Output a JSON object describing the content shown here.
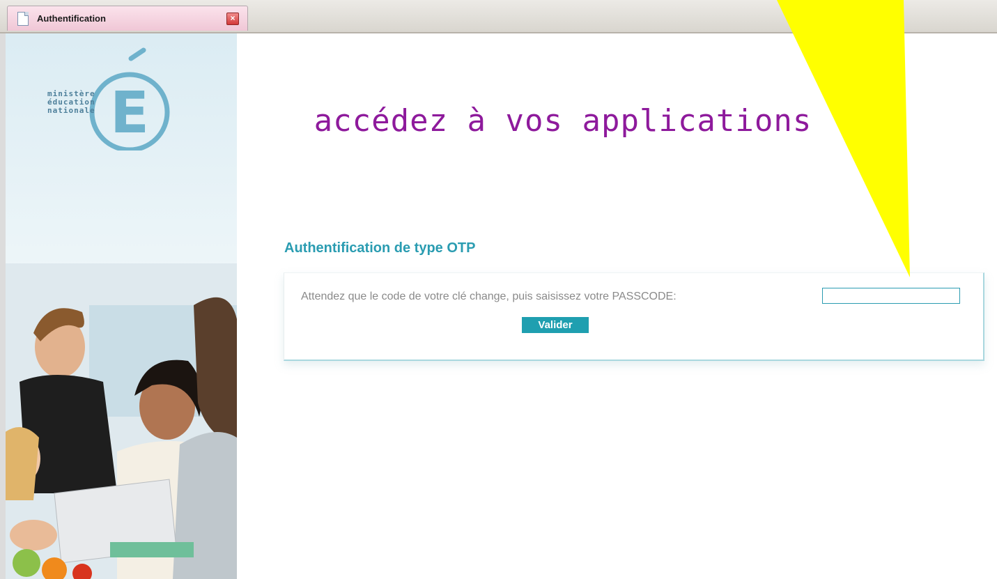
{
  "browser": {
    "tab_title": "Authentification",
    "tab_close_glyph": "×"
  },
  "sidebar": {
    "logo": {
      "letter": "É",
      "text_lines": [
        "ministère",
        "éducation",
        "nationale"
      ]
    }
  },
  "main": {
    "title": "accédez à vos applications",
    "section_title": "Authentification de type OTP",
    "prompt": "Attendez que le code de votre clé change, puis saisissez votre PASSCODE:",
    "passcode_value": "",
    "submit_label": "Valider"
  },
  "colors": {
    "title": "#8e1a9c",
    "accent": "#2a9cb1",
    "button": "#1f9fb0",
    "annotation_arrow": "#ffff00"
  }
}
